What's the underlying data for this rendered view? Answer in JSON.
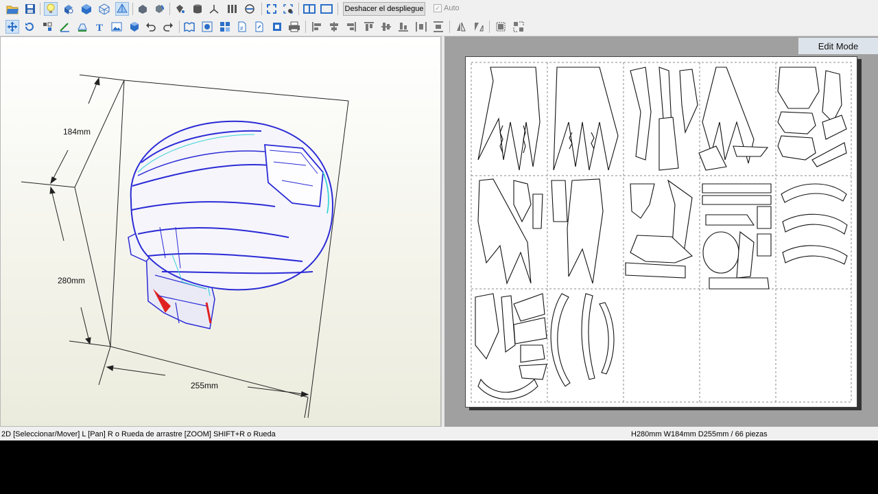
{
  "toolbar": {
    "undo_unfold_label": "Deshacer el despliegue",
    "auto_label": "Auto",
    "auto_checked": true,
    "row1_icons": [
      "open-folder-icon",
      "save-icon",
      "light-bulb-icon",
      "texture-toggle-icon",
      "solid-view-icon",
      "wireframe-view-icon",
      "edge-view-icon",
      "paint-bucket-icon",
      "rotate-icon",
      "bucket-icon",
      "cylinder-icon",
      "axis-icon",
      "columns-icon",
      "join-icon",
      "fit-all-icon",
      "zoom-select-icon",
      "single-view-icon",
      "maximize-view-icon"
    ],
    "row2_icons": [
      "select-move-icon",
      "rotate-part-icon",
      "arrange-icon",
      "edit-line-icon",
      "flap-icon",
      "text-tool-icon",
      "image-tool-icon",
      "box-icon",
      "undo-icon",
      "redo-icon",
      "print-setup-icon",
      "join-parts-icon",
      "grid-icon",
      "page-number-icon",
      "export-icon",
      "screenshot-icon",
      "print-icon",
      "align-left-icon",
      "align-center-icon",
      "align-right-icon",
      "align-top-icon",
      "align-middle-icon",
      "align-bottom-icon",
      "distribute-h-icon",
      "distribute-v-icon",
      "flip-h-icon",
      "flip-v-icon",
      "group-icon",
      "ungroup-icon"
    ]
  },
  "view3d": {
    "dim_width": "184mm",
    "dim_height": "280mm",
    "dim_depth": "255mm"
  },
  "view2d": {
    "mode_label": "Edit Mode",
    "page_cols": 5,
    "page_rows": 3
  },
  "status": {
    "hint": "2D [Seleccionar/Mover] L [Pan] R o Rueda de arrastre [ZOOM] SHIFT+R o Rueda",
    "summary": "H280mm W184mm D255mm / 66 piezas"
  },
  "colors": {
    "wire_blue": "#2a2ad6",
    "wire_cyan": "#39d4d4",
    "wire_red": "#e02020",
    "icon_blue": "#2b6fc8"
  }
}
